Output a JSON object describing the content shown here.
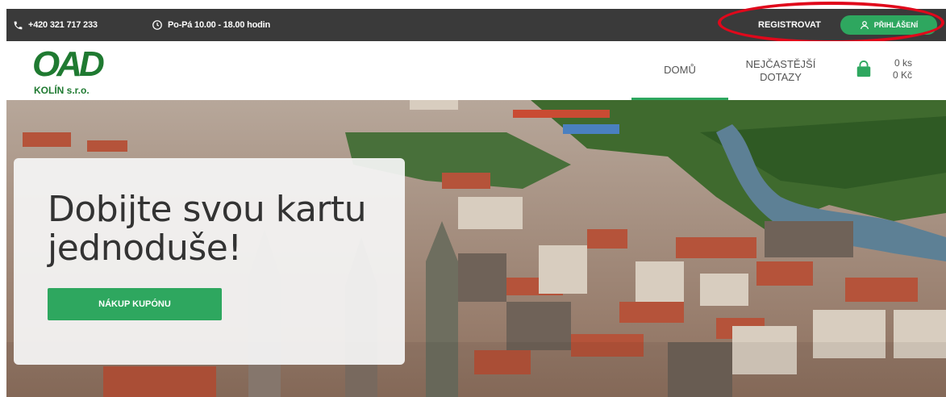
{
  "topbar": {
    "phone": "+420 321 717 233",
    "hours": "Po-Pá 10.00 - 18.00 hodin",
    "register_label": "REGISTROVAT",
    "login_label": "PŘIHLÁŠENÍ",
    "icons": {
      "phone": "phone-icon",
      "clock": "clock-icon",
      "user": "user-icon"
    }
  },
  "header": {
    "logo_main": "OAD",
    "logo_sub": "KOLÍN s.r.o.",
    "nav": {
      "home": "DOMŮ",
      "faq_line1": "NEJČASTĚJŠÍ",
      "faq_line2": "DOTAZY"
    },
    "cart": {
      "count": "0 ks",
      "price": "0 Kč",
      "icon": "shopping-bag-icon"
    }
  },
  "hero": {
    "title_line1": "Dobijte svou kartu",
    "title_line2": "jednoduše!",
    "button_label": "NÁKUP KUPÓNU"
  },
  "colors": {
    "accent": "#2ea75f",
    "topbar": "#3a3a3a",
    "logo": "#1f7a31",
    "highlight": "#e0081b"
  }
}
